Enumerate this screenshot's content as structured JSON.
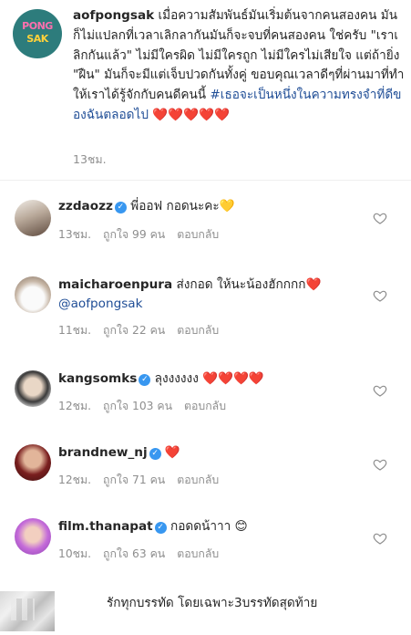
{
  "post": {
    "avatar_logo_top": "PONG",
    "avatar_logo_bottom": "SAK",
    "username": "aofpongsak",
    "caption_text": " เมื่อความสัมพันธ์มันเริ่มต้นจากคนสองคน มันก็ไม่แปลกที่เวลาเลิกลากันมันก็จะจบที่คนสองคน ใช่ครับ \"เราเลิกกันแล้ว\" ไม่มีใครผิด ไม่มีใครถูก ไม่มีใครไม่เสียใจ แต่ถ้ายิ่ง \"ฝืน\" มันก็จะมีแต่เจ็บปวดกันทั้งคู่ ขอบคุณเวลาดีๆที่ผ่านมาที่ทำให้เราได้รู้จักกับคนดีคนนี้ ",
    "hashtag": "#เธอจะเป็นหนึ่งในความทรงจำที่ดีของฉันตลอดไป",
    "hearts": " ❤️❤️❤️❤️❤️",
    "time": "13ชม."
  },
  "comments": [
    {
      "username": "zzdaozz",
      "verified": true,
      "text": " พี่ออฟ กอดนะคะ💛",
      "time": "13ชม.",
      "likes": "ถูกใจ 99 คน",
      "reply": "ตอบกลับ"
    },
    {
      "username": "maicharoenpura",
      "verified": false,
      "text": " ส่งกอด ให้นะน้องฮักกกก❤️ ",
      "mention": "@aofpongsak",
      "time": "11ชม.",
      "likes": "ถูกใจ 22 คน",
      "reply": "ตอบกลับ"
    },
    {
      "username": "kangsomks",
      "verified": true,
      "text": " ลุงงงงงง ❤️❤️❤️❤️",
      "time": "12ชม.",
      "likes": "ถูกใจ 103 คน",
      "reply": "ตอบกลับ"
    },
    {
      "username": "brandnew_nj",
      "verified": true,
      "text": " ❤️",
      "time": "12ชม.",
      "likes": "ถูกใจ 71 คน",
      "reply": "ตอบกลับ"
    },
    {
      "username": "film.thanapat",
      "verified": true,
      "text": " กอดดน้าาา 😊",
      "time": "10ชม.",
      "likes": "ถูกใจ 63 คน",
      "reply": "ตอบกลับ"
    },
    {
      "username": "",
      "verified": false,
      "text": "รักทุกบรรทัด โดยเฉพาะ3บรรทัดสุดท้าย"
    }
  ],
  "icons": {
    "like": "heart-outline-icon",
    "verified": "verified-badge-icon"
  },
  "colors": {
    "link": "#1f4d96",
    "meta": "#8e8e8e",
    "verified": "#3897f0",
    "heart": "#e3343f"
  },
  "glyphs": {
    "verified_check": "✓"
  }
}
